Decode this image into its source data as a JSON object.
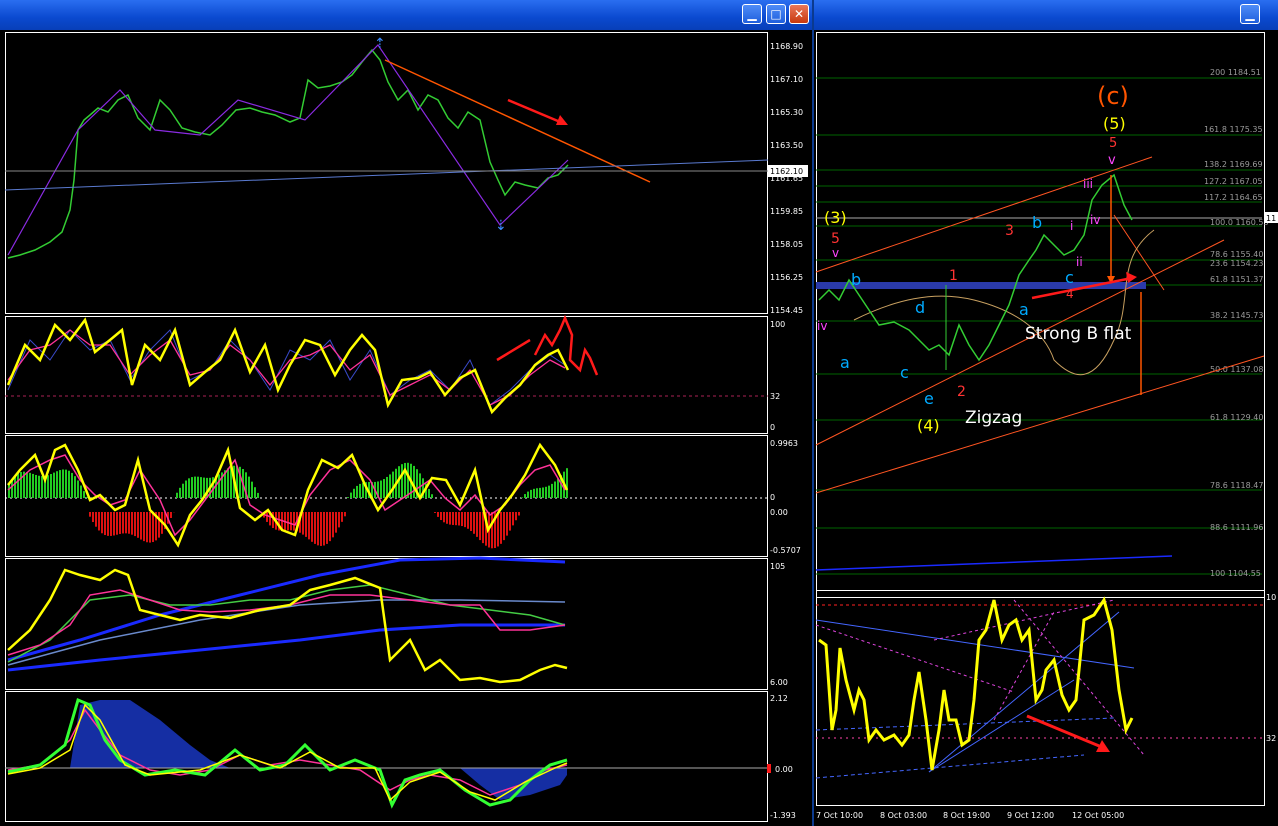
{
  "left_window": {
    "buttons": {
      "minimize": "▁",
      "maximize": "□",
      "close": "✕"
    },
    "price_axis": [
      "1168.90",
      "1167.10",
      "1165.30",
      "1163.50",
      "1161.65",
      "1159.85",
      "1158.05",
      "1156.25",
      "1154.45"
    ],
    "current_price": "1162.10",
    "ind1_axis": [
      "100",
      "32",
      "0"
    ],
    "ind2_axis": [
      "0.9963",
      "0",
      "0.00",
      "-0.5707"
    ],
    "ind3_axis": [
      "105",
      "6.00"
    ],
    "ind4_axis": [
      "2.12",
      "0.00",
      "-1.393"
    ]
  },
  "right_window": {
    "buttons": {
      "minimize": "▁"
    },
    "fib_levels": [
      "200 1184.51",
      "161.8 1175.35",
      "138.2 1169.69",
      "127.2 1167.05",
      "117.2 1164.65",
      "100.0 1160.53",
      "78.6 1155.40",
      "23.6 1154.23",
      "61.8 1151.37",
      "38.2 1145.73",
      "50.0 1137.08",
      "61.8 1129.40",
      "78.6 1118.47",
      "88.6 1111.96",
      "100 1104.55"
    ],
    "current_price": "11",
    "wave_labels": {
      "c_big": "(c)",
      "five_big": "(5)",
      "five_red": "5",
      "v_top": "v",
      "iii": "iii",
      "iv": "iv",
      "i": "i",
      "ii": "ii",
      "three_yellow": "(3)",
      "five_red2": "5",
      "v_left": "v",
      "iv_left": "iv",
      "b_left": "b",
      "a_left": "a",
      "d": "d",
      "c_left": "c",
      "e": "e",
      "four_yellow": "(4)",
      "one_red": "1",
      "two_red": "2",
      "three_red": "3",
      "b_mid": "b",
      "a_mid": "a",
      "c_mid": "c",
      "four_red": "4",
      "strong_b_flat": "Strong B flat",
      "zigzag": "Zigzag"
    },
    "osc_axis": [
      "10",
      "32"
    ],
    "time_axis": [
      "7 Oct 10:00",
      "8 Oct 03:00",
      "8 Oct 19:00",
      "9 Oct 12:00",
      "12 Oct 05:00"
    ]
  },
  "colors": {
    "candle": "#33cc33",
    "trendline": "#ff5500",
    "arrow": "#ff1a1a",
    "stoch": "#ffff00",
    "fib": "#006400"
  }
}
